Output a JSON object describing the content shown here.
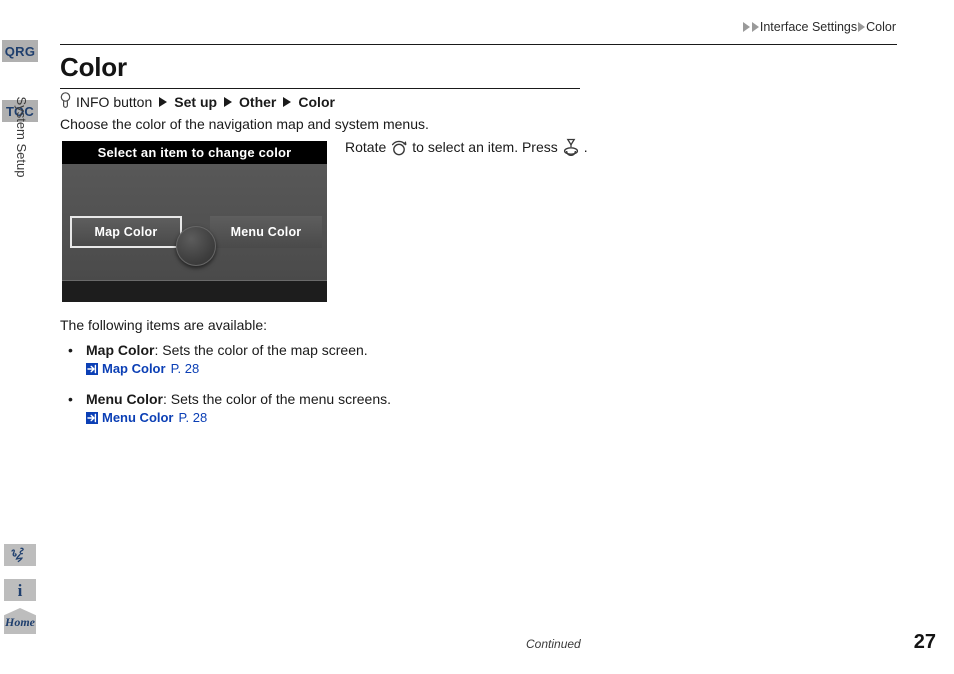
{
  "sidebar": {
    "tabs": [
      {
        "label": "QRG",
        "name": "sidebar-tab-qrg"
      },
      {
        "label": "TOC",
        "name": "sidebar-tab-toc"
      }
    ],
    "section_label": "System Setup",
    "icons": [
      {
        "name": "voice-command-icon",
        "glyph": ""
      },
      {
        "name": "info-icon",
        "glyph": "i"
      }
    ],
    "home_label": "Home"
  },
  "breadcrumb": {
    "parent": "Interface Settings",
    "current": "Color"
  },
  "page": {
    "title": "Color",
    "path": {
      "button_label": "INFO button",
      "steps": [
        "Set up",
        "Other",
        "Color"
      ]
    },
    "intro": "Choose the color of the navigation map and system menus.",
    "available_intro": "The following items are available:"
  },
  "navshot": {
    "title": "Select an item to change color",
    "buttons": [
      {
        "label": "Map Color",
        "selected": true
      },
      {
        "label": "Menu Color",
        "selected": false
      }
    ]
  },
  "caption": {
    "rotate_text": "Rotate",
    "middle_text": "to select an item. Press",
    "end_text": "."
  },
  "items": [
    {
      "bullet": "•",
      "term": "Map Color",
      "description": ": Sets the color of the map screen.",
      "xref_label": "Map Color",
      "xref_page": "P. 28"
    },
    {
      "bullet": "•",
      "term": "Menu Color",
      "description": ": Sets the color of the menu screens.",
      "xref_label": "Menu Color",
      "xref_page": "P. 28"
    }
  ],
  "footer": {
    "continued": "Continued",
    "page_number": "27"
  },
  "colors": {
    "tab_bg": "#b0b0b0",
    "tab_text": "#1f3f6e",
    "link_blue": "#0b3fb5",
    "nav_title_bar": "#000000"
  }
}
